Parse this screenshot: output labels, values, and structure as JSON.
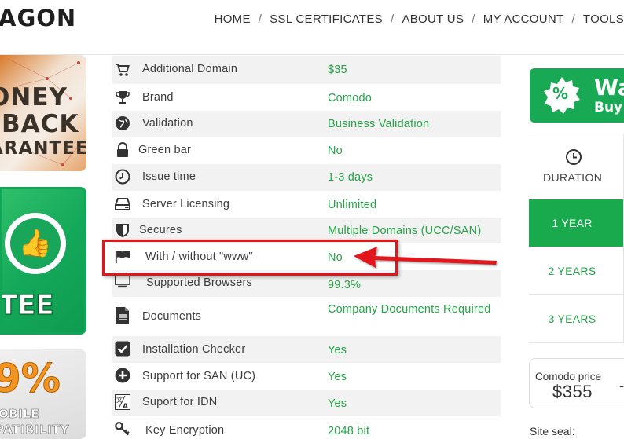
{
  "header": {
    "logo_text": "AGON",
    "nav": [
      "HOME",
      "SSL CERTIFICATES",
      "ABOUT US",
      "MY ACCOUNT",
      "TOOLS"
    ],
    "separator": "/"
  },
  "banners": {
    "money_back": [
      "ONEY",
      "BACK",
      "ARANTEE"
    ],
    "guarantee": "TEE",
    "mobile": {
      "percent": "9%",
      "line1": "OBILE",
      "line2": "PATIBILITY"
    }
  },
  "specs": [
    {
      "label": "Additional Domain",
      "value": "$35",
      "icon": "cart-icon"
    },
    {
      "label": "Brand",
      "value": "Comodo",
      "icon": "trophy-icon"
    },
    {
      "label": "Validation",
      "value": "Business Validation",
      "icon": "globe-icon"
    },
    {
      "label": "Green bar",
      "value": "No",
      "icon": "lock-icon"
    },
    {
      "label": "Issue time",
      "value": "1-3 days",
      "icon": "clock-icon"
    },
    {
      "label": "Server Licensing",
      "value": "Unlimited",
      "icon": "server-icon"
    },
    {
      "label": "Secures",
      "value": "Multiple Domains (UCC/SAN)",
      "icon": "shield-icon"
    },
    {
      "label": "With / without \"www\"",
      "value": "No",
      "icon": "flag-icon"
    },
    {
      "label": "Supported Browsers",
      "value": "99.3%",
      "icon": "monitor-icon"
    },
    {
      "label": "Documents",
      "value": "Company Documents Required",
      "icon": "document-icon"
    },
    {
      "label": "Installation Checker",
      "value": "Yes",
      "icon": "checkbox-icon"
    },
    {
      "label": "Support for SAN (UC)",
      "value": "Yes",
      "icon": "plus-circle-icon"
    },
    {
      "label": "Suport for IDN",
      "value": "Yes",
      "icon": "translate-icon"
    },
    {
      "label": "Key Encryption",
      "value": "2048 bit",
      "icon": "key-icon"
    }
  ],
  "promo": {
    "title": "Wa",
    "subtitle": "Buy",
    "badge_symbol": "%"
  },
  "duration": {
    "header": "DURATION",
    "options": [
      "1 YEAR",
      "2 YEARS",
      "3 YEARS"
    ],
    "selected": "1 YEAR"
  },
  "price": {
    "label": "Comodo price",
    "amount": "$355",
    "suffix": "-"
  },
  "seal_label": "Site seal:",
  "colors": {
    "green": "#25a448",
    "accent_green": "#1aaa4e",
    "annotation_red": "#e3151b"
  }
}
